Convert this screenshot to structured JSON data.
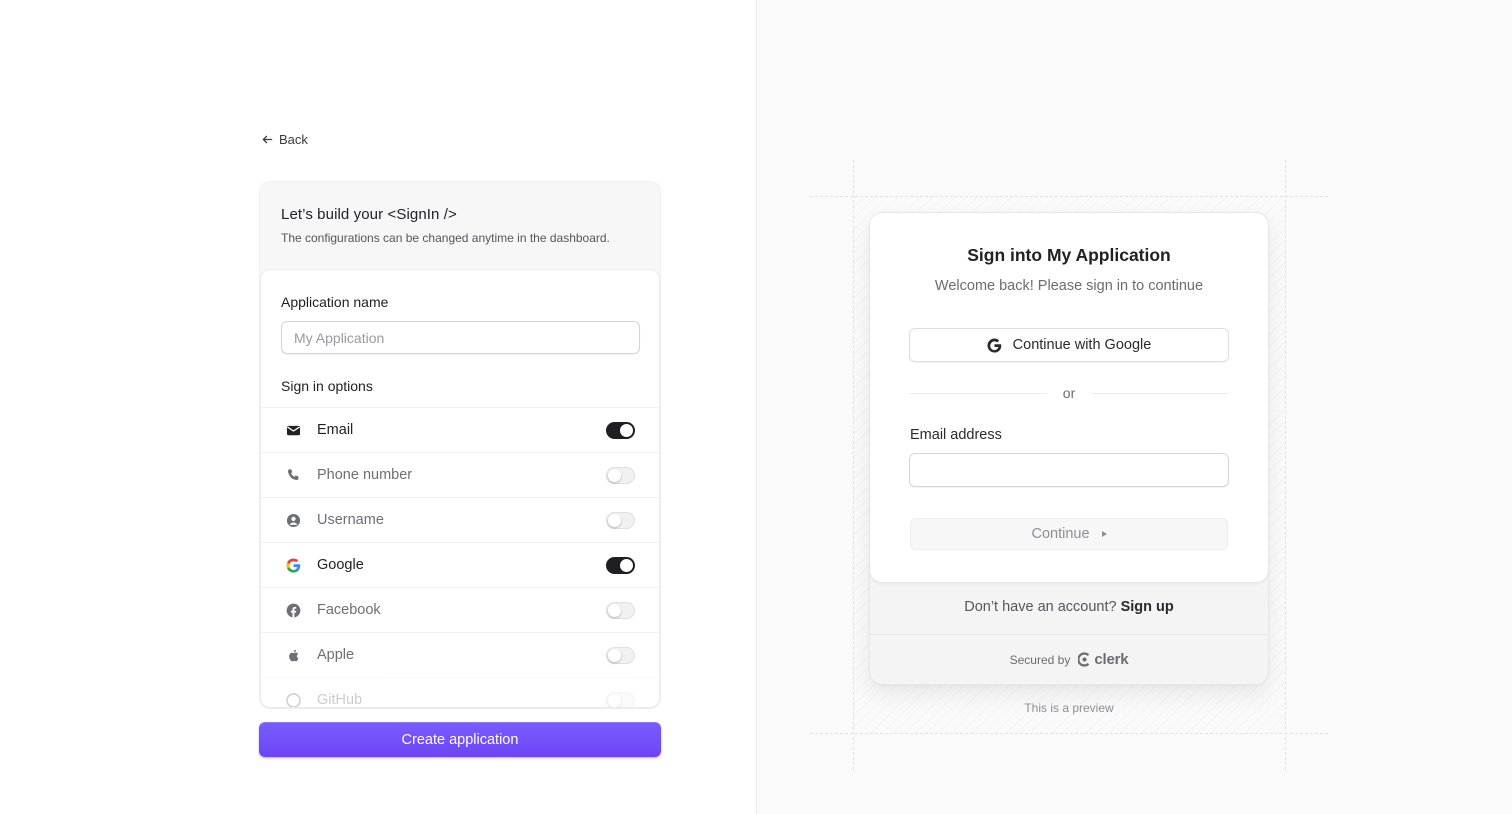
{
  "back": {
    "label": "Back"
  },
  "config": {
    "title": "Let’s build your <SignIn />",
    "subtitle": "The configurations can be changed anytime in the dashboard.",
    "app_name_label": "Application name",
    "app_name_placeholder": "My Application",
    "app_name_value": "",
    "sign_in_options_label": "Sign in options",
    "options": [
      {
        "label": "Email",
        "icon": "mail-icon",
        "enabled": true
      },
      {
        "label": "Phone number",
        "icon": "phone-icon",
        "enabled": false
      },
      {
        "label": "Username",
        "icon": "user-circle-icon",
        "enabled": false
      },
      {
        "label": "Google",
        "icon": "google-icon",
        "enabled": true
      },
      {
        "label": "Facebook",
        "icon": "facebook-icon",
        "enabled": false
      },
      {
        "label": "Apple",
        "icon": "apple-icon",
        "enabled": false
      },
      {
        "label": "GitHub",
        "icon": "github-icon",
        "enabled": false
      }
    ],
    "create_button": "Create application"
  },
  "preview": {
    "title": "Sign into My Application",
    "subtitle": "Welcome back! Please sign in to continue",
    "google_button": "Continue with Google",
    "divider": "or",
    "email_label": "Email address",
    "email_value": "",
    "continue_button": "Continue",
    "signup_prompt": "Don’t have an account?",
    "signup_link": "Sign up",
    "secured_by": "Secured by",
    "brand": "clerk",
    "note": "This is a preview"
  },
  "colors": {
    "accent": "#6c47ff",
    "toggle_on": "#1f1f23",
    "toggle_off": "#f1f1f3",
    "right_bg": "#fafafa"
  }
}
